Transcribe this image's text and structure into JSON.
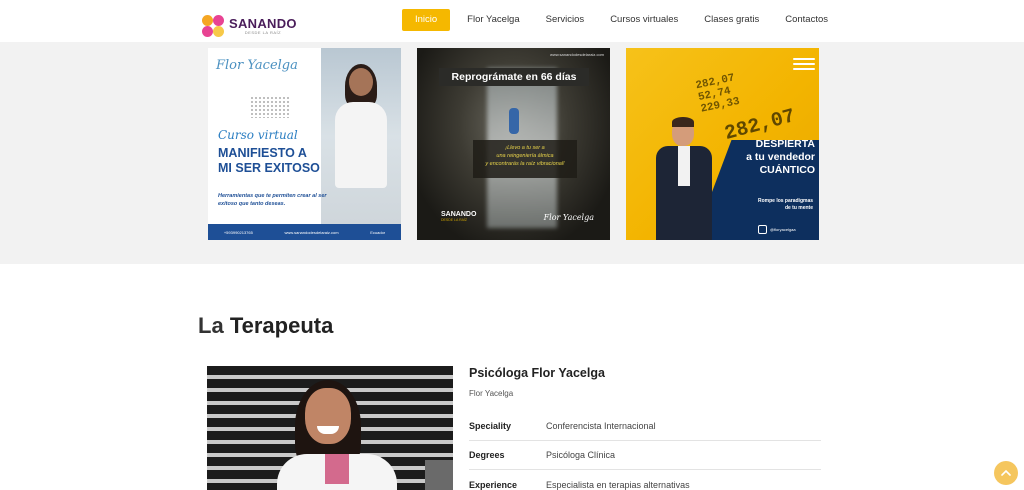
{
  "header": {
    "logo": {
      "name": "SANANDO",
      "tagline": "DESDE LA RAÍZ"
    },
    "nav": [
      {
        "label": "Inicio",
        "active": true
      },
      {
        "label": "Flor Yacelga",
        "active": false
      },
      {
        "label": "Servicios",
        "active": false
      },
      {
        "label": "Cursos virtuales",
        "active": false
      },
      {
        "label": "Clases gratis",
        "active": false
      },
      {
        "label": "Contactos",
        "active": false
      }
    ],
    "accent_color": "#f5b800"
  },
  "gallery": {
    "card1": {
      "brand": "Flor Yacelga",
      "cursive": "Curso virtual",
      "title_line1": "MANIFIESTO A",
      "title_line2": "MI SER EXITOSO",
      "description": "Herramientas que te permiten crear al ser exitoso que tanto deseas.",
      "footer_phone": "+593990213765",
      "footer_web": "www.sanandodesdelaraiz.com",
      "footer_location": "Ecuador"
    },
    "card2": {
      "url": "www.sanandodesdelaraiz.com",
      "headline": "Reprográmate en 66 días",
      "quote_line1": "¡Llevo a tu ser a",
      "quote_line2": "una reingeniería álmica",
      "quote_line3": "y encontrarás la raíz vibracional!",
      "brand": "SANANDO",
      "brand_sub": "DESDE LA RAÍZ",
      "signature": "Flor Yacelga"
    },
    "card3": {
      "numbers_line1": "282,07",
      "numbers_line2": "52,74",
      "numbers_line3": "229,33",
      "big_number": "282,07",
      "title_line1": "DESPIERTA",
      "title_line2": "a tu vendedor",
      "title_line3": "CUÁNTICO",
      "sub_line1": "Rompe los paradigmas",
      "sub_line2": "de tu mente",
      "social": "@floryacelgaa"
    }
  },
  "section": {
    "title_light": "La",
    "title_bold": "Terapeuta"
  },
  "profile": {
    "name": "Psicóloga Flor Yacelga",
    "subtitle": "Flor Yacelga",
    "details": [
      {
        "label": "Speciality",
        "value": "Conferencista Internacional"
      },
      {
        "label": "Degrees",
        "value": "Psicóloga Clínica"
      },
      {
        "label": "Experience",
        "value": "Especialista en terapias alternativas"
      }
    ]
  },
  "icons": {
    "scroll_top": "chevron-up-icon",
    "instagram": "instagram-icon",
    "waves": "waves-icon"
  }
}
